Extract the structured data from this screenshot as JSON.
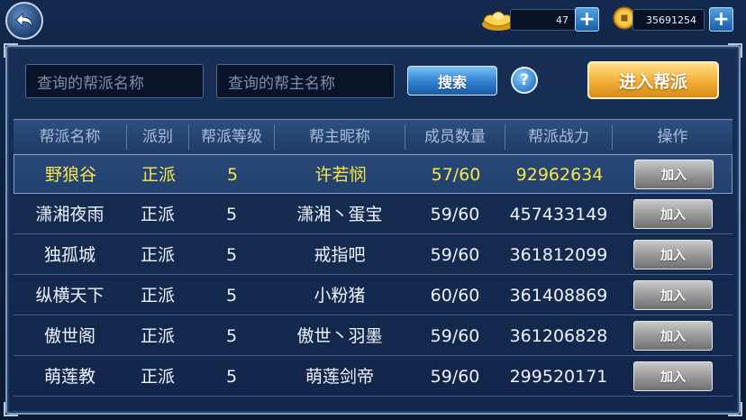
{
  "topbar": {
    "gold_ingot_amount": "47",
    "coin_amount": "35691254"
  },
  "search": {
    "guild_name_placeholder": "查询的帮派名称",
    "leader_name_placeholder": "查询的帮主名称",
    "search_label": "搜索",
    "help_label": "?",
    "enter_guild_label": "进入帮派"
  },
  "table": {
    "headers": [
      "帮派名称",
      "派别",
      "帮派等级",
      "帮主昵称",
      "成员数量",
      "帮派战力",
      "操作"
    ],
    "join_label": "加入",
    "rows": [
      {
        "name": "野狼谷",
        "faction": "正派",
        "level": "5",
        "leader": "许若悯",
        "members": "57/60",
        "power": "92962634"
      },
      {
        "name": "潇湘夜雨",
        "faction": "正派",
        "level": "5",
        "leader": "潇湘丶蛋宝",
        "members": "59/60",
        "power": "457433149"
      },
      {
        "name": "独孤城",
        "faction": "正派",
        "level": "5",
        "leader": "戒指吧",
        "members": "59/60",
        "power": "361812099"
      },
      {
        "name": "纵横天下",
        "faction": "正派",
        "level": "5",
        "leader": "小粉猪",
        "members": "60/60",
        "power": "361408869"
      },
      {
        "name": "傲世阁",
        "faction": "正派",
        "level": "5",
        "leader": "傲世丶羽墨",
        "members": "59/60",
        "power": "361206828"
      },
      {
        "name": "萌莲教",
        "faction": "正派",
        "level": "5",
        "leader": "萌莲剑帝",
        "members": "59/60",
        "power": "299520171"
      }
    ]
  },
  "colors": {
    "highlight_text": "#f7e54a",
    "normal_text": "#eef2f8",
    "header_text": "#a9bdd6",
    "accent_gold": "#f3b23a",
    "accent_blue": "#2f7fd0"
  }
}
